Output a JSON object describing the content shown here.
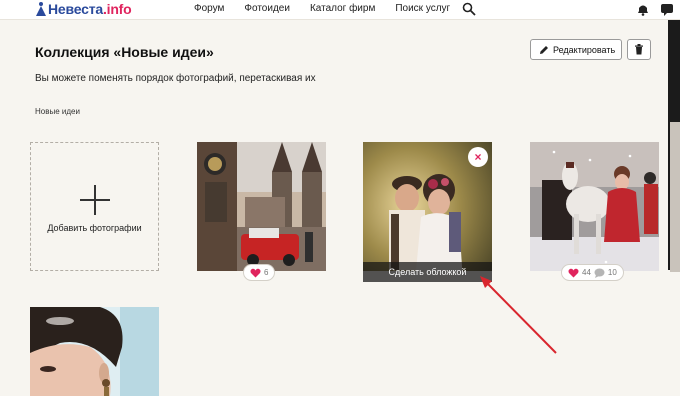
{
  "header": {
    "logo_text": "Невеста",
    "logo_suffix": ".info",
    "nav": [
      "Форум",
      "Фотоидеи",
      "Каталог фирм",
      "Поиск услуг"
    ]
  },
  "page": {
    "title": "Коллекция «Новые идеи»",
    "subtitle": "Вы можете поменять порядок фотографий, перетаскивая их",
    "collection_label": "Новые идеи",
    "edit_label": "Редактировать"
  },
  "tiles": {
    "add_label": "Добавить фотографии",
    "photo1_likes": "6",
    "cover_label": "Сделать обложкой",
    "photo3_likes": "44",
    "photo3_comments": "10"
  },
  "colors": {
    "brand": "#2a4a9c",
    "accent": "#e0245e",
    "annotation_arrow": "#d9262e"
  }
}
